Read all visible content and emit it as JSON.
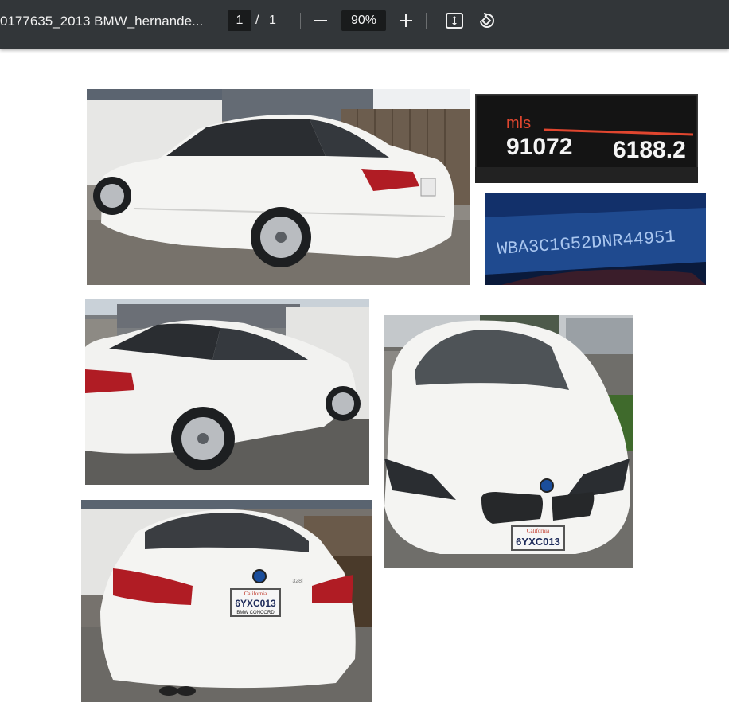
{
  "viewer": {
    "title": "0177635_2013 BMW_hernande...",
    "page_current": "1",
    "page_separator": "/",
    "page_total": "1",
    "zoom": "90%"
  },
  "icons": {
    "zoom_out": "minus-icon",
    "zoom_in": "plus-icon",
    "fit_page": "fit-to-page-icon",
    "rotate": "rotate-icon"
  },
  "photos": {
    "odometer": {
      "unit": "mls",
      "trip": "91072",
      "range": "6188.2"
    },
    "vin": {
      "text": "WBA3C1G52DNR44951"
    },
    "rear_plate": {
      "top": "California",
      "number": "6YXC013",
      "frame": "BMW CONCORD"
    },
    "front_plate": {
      "top": "California",
      "number": "6YXC013"
    },
    "rear_badge": "328i"
  },
  "colors": {
    "toolbar": "#323639",
    "car_white": "#f4f4f2",
    "taillight": "#b01c24",
    "vin_plate": "#1f4a8f"
  }
}
